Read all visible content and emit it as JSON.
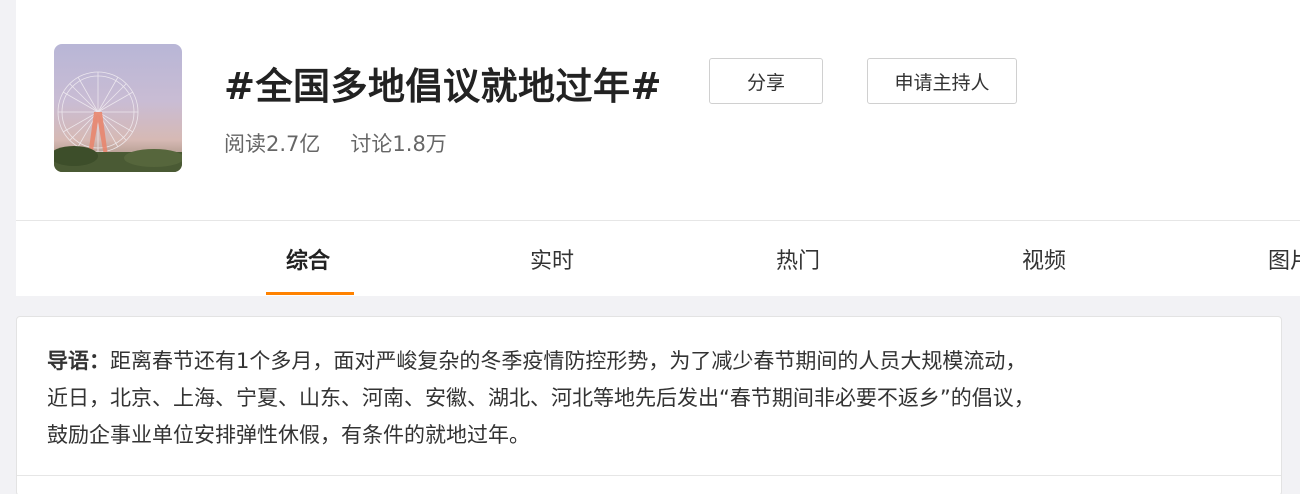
{
  "topic": {
    "title": "#全国多地倡议就地过年#",
    "share_label": "分享",
    "host_label": "申请主持人",
    "reads": "阅读2.7亿",
    "discussions": "讨论1.8万"
  },
  "tabs": [
    {
      "label": "综合",
      "active": true
    },
    {
      "label": "实时",
      "active": false
    },
    {
      "label": "热门",
      "active": false
    },
    {
      "label": "视频",
      "active": false
    },
    {
      "label": "图片",
      "active": false
    }
  ],
  "intro": {
    "label": "导语：",
    "lines": [
      "距离春节还有1个多月，面对严峻复杂的冬季疫情防控形势，为了减少春节期间的人员大规模流动，",
      "近日，北京、上海、宁夏、山东、河南、安徽、湖北、河北等地先后发出“春节期间非必要不返乡”的倡议，",
      "鼓励企事业单位安排弹性休假，有条件的就地过年。"
    ]
  },
  "colors": {
    "accent": "#ff8200",
    "background": "#f2f2f5"
  }
}
